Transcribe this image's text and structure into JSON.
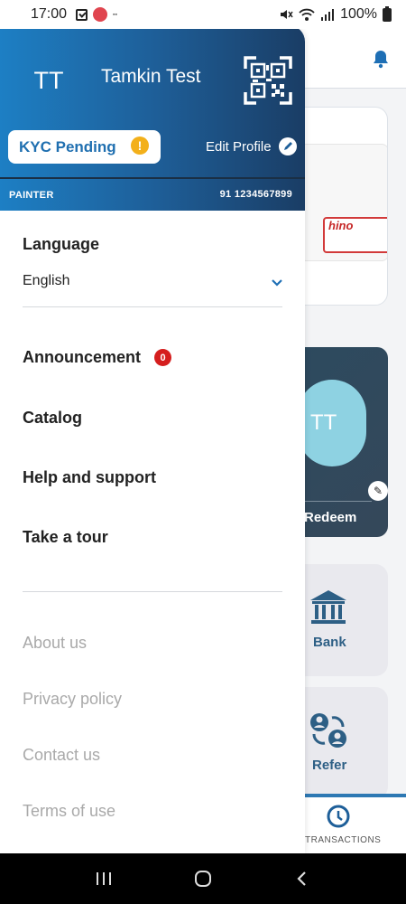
{
  "status_bar": {
    "time": "17:00",
    "battery": "100%"
  },
  "drawer": {
    "avatar_initials": "TT",
    "user_name": "Tamkin Test",
    "kyc_status": "KYC Pending",
    "edit_profile_label": "Edit Profile",
    "role": "PAINTER",
    "phone": "91 1234567899",
    "language": {
      "title": "Language",
      "selected": "English"
    },
    "menu": [
      {
        "label": "Announcement",
        "badge": "0"
      },
      {
        "label": "Catalog"
      },
      {
        "label": "Help and support"
      },
      {
        "label": "Take a tour"
      }
    ],
    "links": [
      {
        "label": "About us"
      },
      {
        "label": "Privacy policy"
      },
      {
        "label": "Contact us"
      },
      {
        "label": "Terms of use"
      }
    ]
  },
  "background": {
    "product_label": "hino",
    "profile_initials": "TT",
    "redeem_label": "Redeem",
    "bank_label": "Bank",
    "refer_label": "Refer",
    "transactions_label": "TRANSACTIONS"
  },
  "colors": {
    "brand_blue": "#1e6fb5",
    "header_dark": "#1a3d65",
    "kyc_text": "#1f6fb0",
    "warning": "#f3b01a",
    "badge_red": "#d51e1e",
    "muted_text": "#a9a9a9"
  },
  "icons": [
    "qr-code-icon",
    "warning-icon",
    "edit-icon",
    "chevron-down-icon",
    "bell-icon",
    "bank-icon",
    "refer-icon",
    "transactions-icon",
    "nav-recents-icon",
    "nav-home-icon",
    "nav-back-icon"
  ]
}
